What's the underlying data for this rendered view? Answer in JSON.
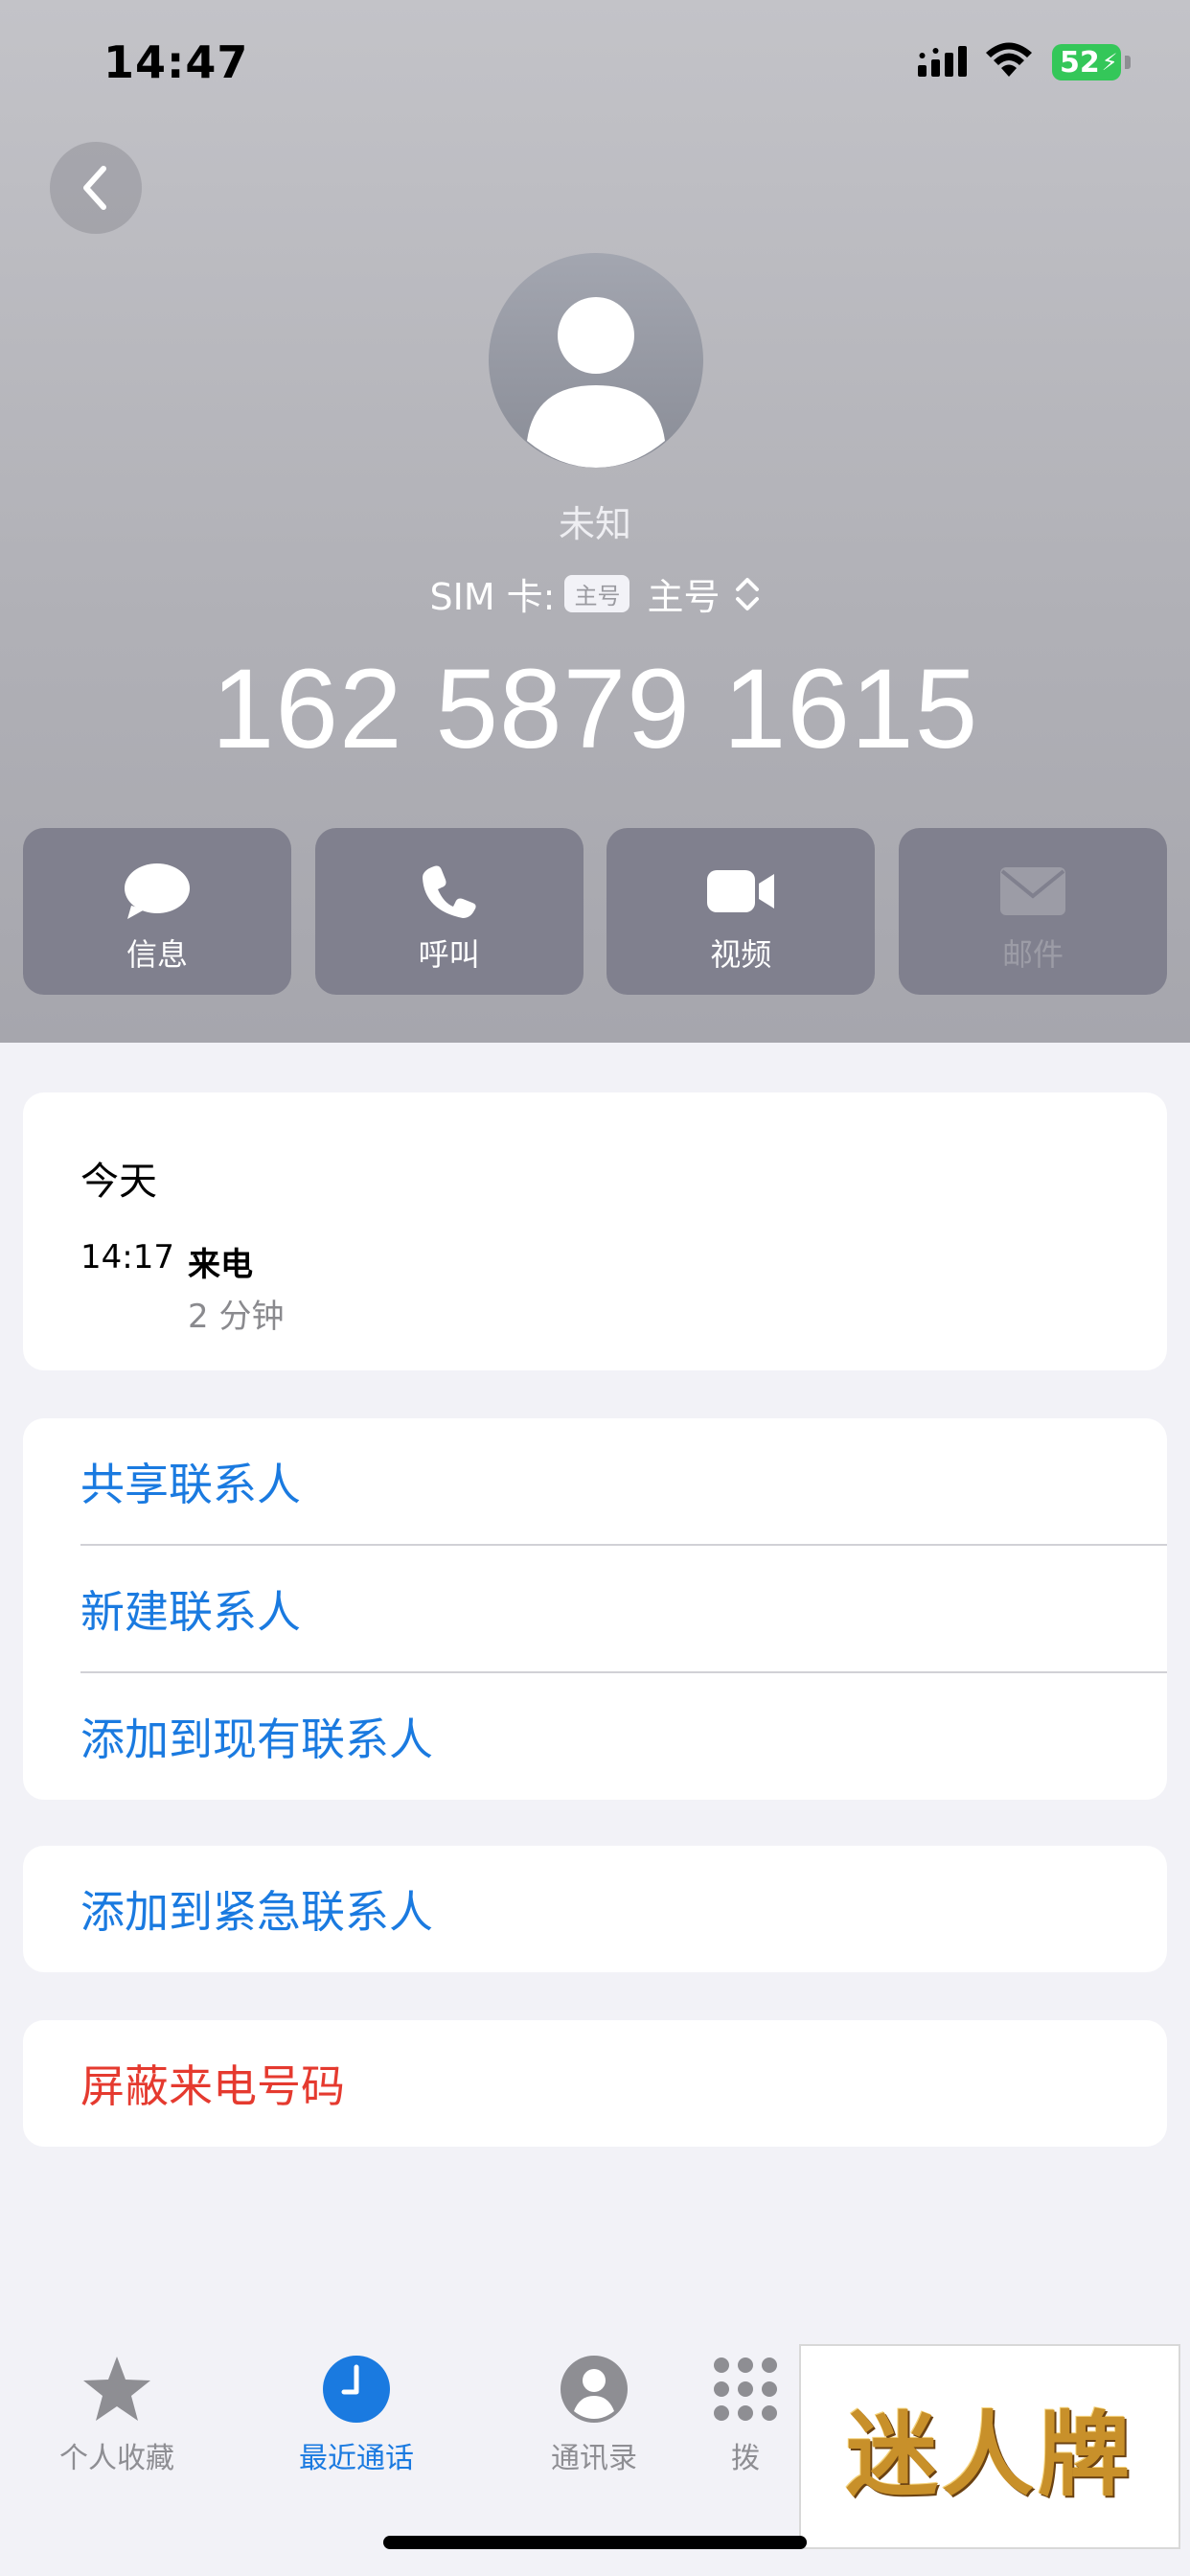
{
  "status_bar": {
    "time": "14:47",
    "battery": "52"
  },
  "contact": {
    "name": "未知",
    "sim_label": "SIM 卡:",
    "sim_badge": "主号",
    "sim_value": "主号",
    "phone_number": "162 5879 1615"
  },
  "actions": [
    {
      "label": "信息",
      "icon": "message-icon",
      "enabled": true
    },
    {
      "label": "呼叫",
      "icon": "phone-icon",
      "enabled": true
    },
    {
      "label": "视频",
      "icon": "video-icon",
      "enabled": true
    },
    {
      "label": "邮件",
      "icon": "mail-icon",
      "enabled": false
    }
  ],
  "recent": {
    "day": "今天",
    "time": "14:17",
    "type": "来电",
    "duration": "2 分钟"
  },
  "options": {
    "share_contact": "共享联系人",
    "new_contact": "新建联系人",
    "add_existing": "添加到现有联系人",
    "add_emergency": "添加到紧急联系人",
    "block_caller": "屏蔽来电号码"
  },
  "tabs": [
    {
      "label": "个人收藏",
      "icon": "star-icon"
    },
    {
      "label": "最近通话",
      "icon": "clock-icon",
      "active": true
    },
    {
      "label": "通讯录",
      "icon": "person-icon"
    },
    {
      "label": "拨",
      "icon": "keypad-icon"
    }
  ],
  "watermark": "迷人牌",
  "colors": {
    "link": "#1a7ae0",
    "destructive": "#e53a2f",
    "battery": "#34c759"
  }
}
